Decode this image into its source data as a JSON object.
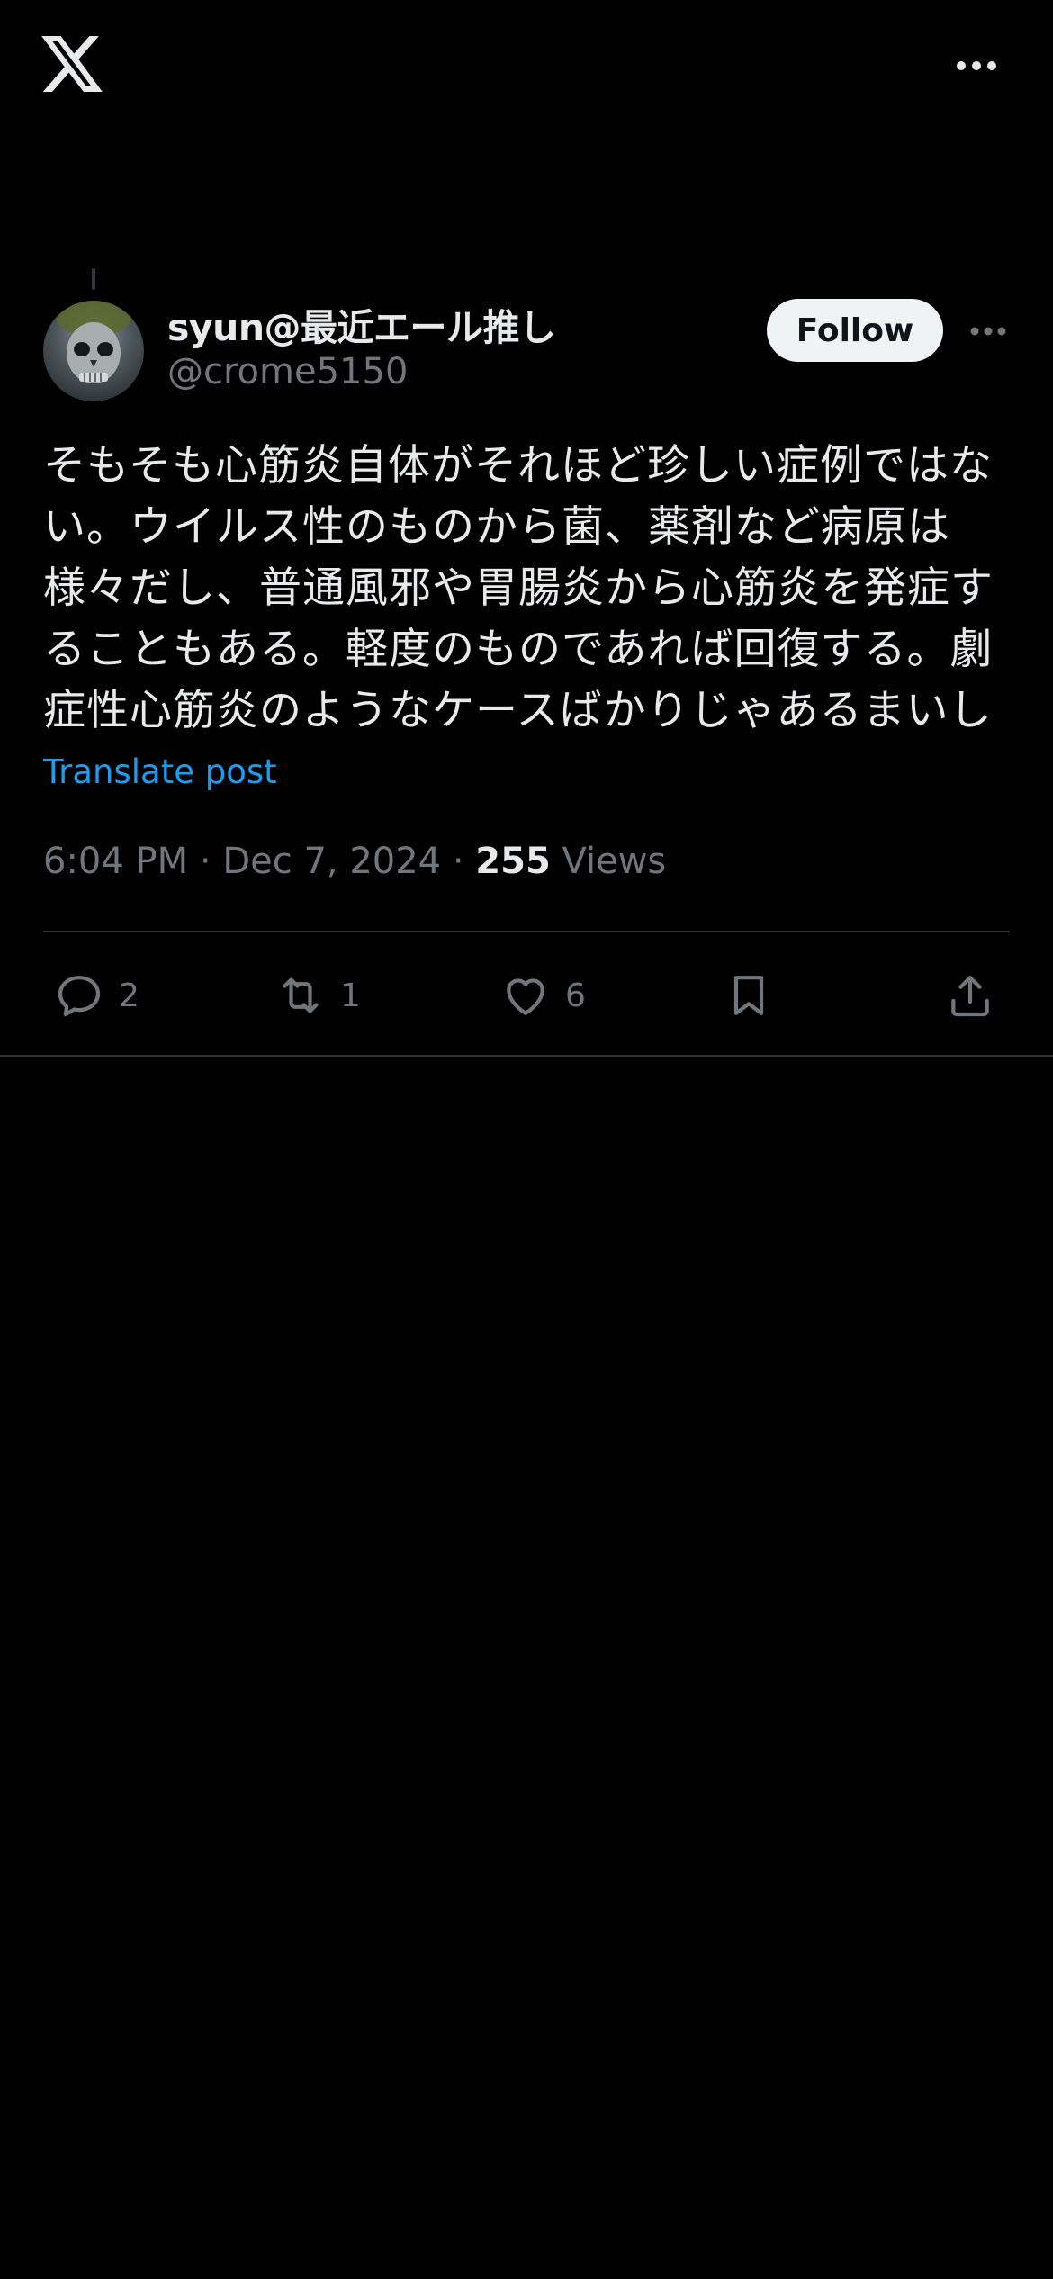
{
  "topbar": {
    "logo_icon": "x-logo-icon",
    "more_icon": "more-horizontal-icon"
  },
  "post": {
    "author": {
      "display_name": "syun@最近エール推し",
      "handle": "@crome5150",
      "avatar_icon": "skull-avatar"
    },
    "follow_label": "Follow",
    "text": "そもそも心筋炎自体がそれほど珍しい症例ではない。ウイルス性のものから菌、薬剤など病原は様々だし、普通風邪や胃腸炎から心筋炎を発症することもある。軽度のものであれば回復する。劇症性心筋炎のようなケースばかりじゃあるまいし",
    "translate_label": "Translate post",
    "time": "6:04 PM",
    "date": "Dec 7, 2024",
    "separator": "·",
    "views_count": "255",
    "views_label": "Views",
    "actions": {
      "replies": "2",
      "reposts": "1",
      "likes": "6"
    }
  },
  "colors": {
    "background": "#000000",
    "text_primary": "#e7e9ea",
    "text_secondary": "#71767b",
    "link": "#1d9bf0",
    "divider": "#2f3336",
    "follow_bg": "#eff3f4"
  }
}
